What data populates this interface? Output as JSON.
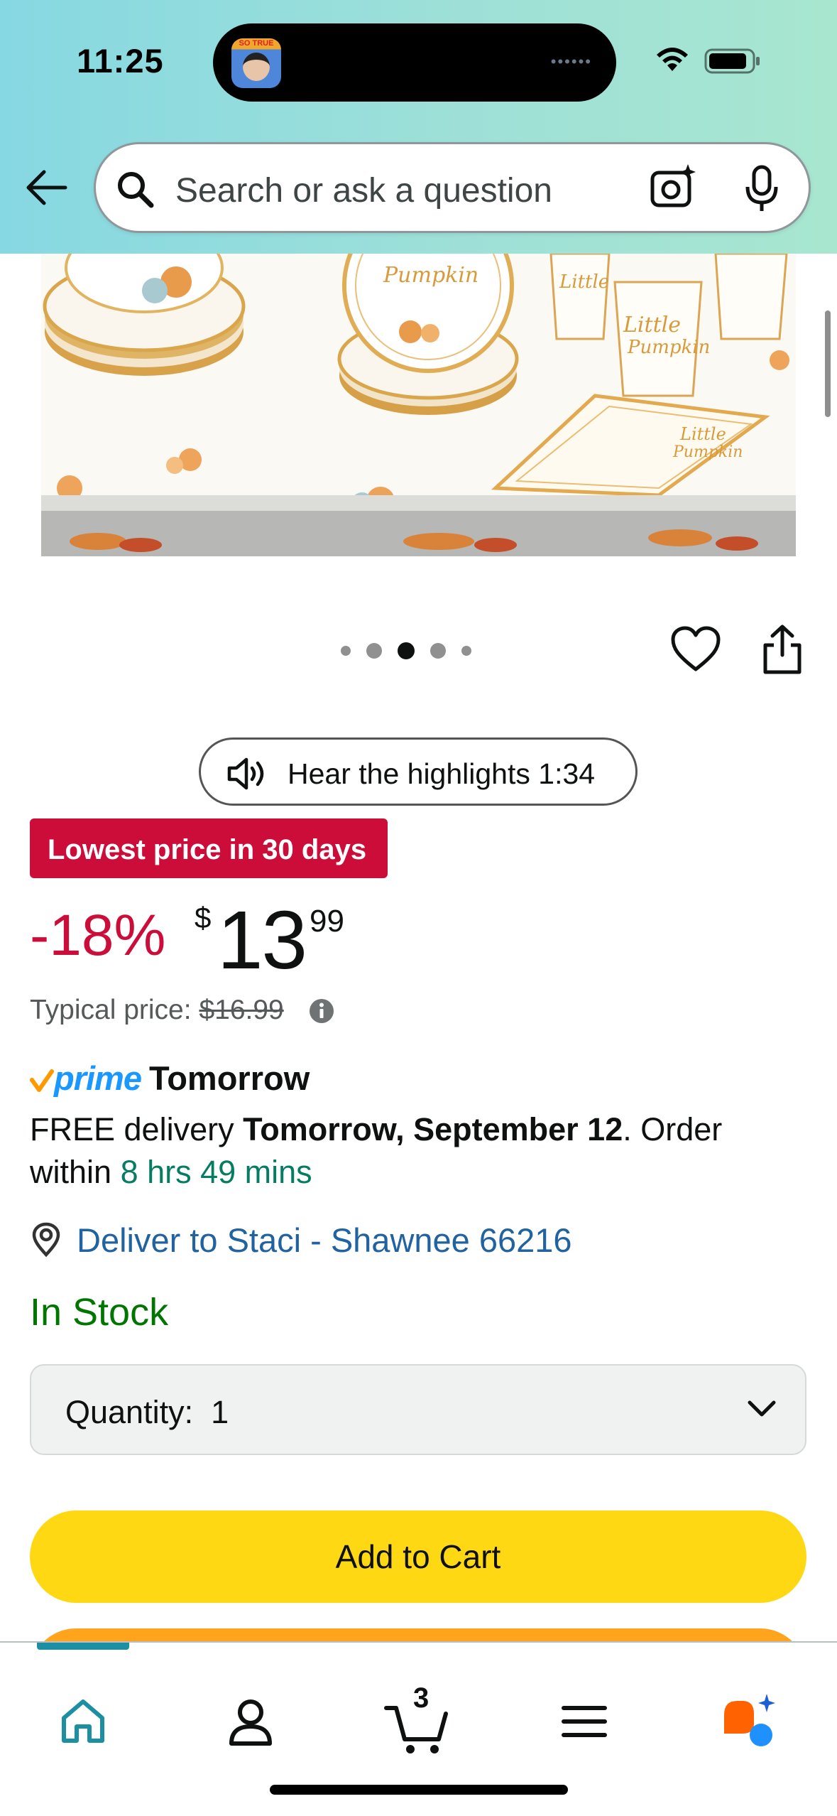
{
  "status_bar": {
    "time": "11:25",
    "island_badge": "SO TRUE"
  },
  "header": {
    "back_icon": "arrow-left-icon",
    "search_placeholder": "Search or ask a question",
    "camera_icon": "camera-sparkle-icon",
    "mic_icon": "microphone-icon"
  },
  "gallery": {
    "dots_count": 5,
    "active_dot": 3,
    "wishlist_icon": "heart-icon",
    "share_icon": "share-icon"
  },
  "audio": {
    "label": "Hear the highlights 1:34",
    "icon": "speaker-icon"
  },
  "pricing": {
    "deal_badge": "Lowest price in 30 days",
    "discount": "-18%",
    "currency_symbol": "$",
    "price_whole": "13",
    "price_fraction": "99",
    "typical_label": "Typical price:",
    "typical_price": "$16.99"
  },
  "delivery": {
    "prime_label": "prime",
    "prime_day": "Tomorrow",
    "free_text": "FREE delivery ",
    "date": "Tomorrow, September 12",
    "order_text": ". Order within ",
    "countdown": "8 hrs 49 mins",
    "deliver_to": "Deliver to Staci - Shawnee 66216"
  },
  "stock": {
    "status": "In Stock"
  },
  "quantity": {
    "label": "Quantity:",
    "value": "1"
  },
  "actions": {
    "add_to_cart": "Add to Cart"
  },
  "bottom_nav": {
    "items": [
      "home-icon",
      "account-icon",
      "cart-icon",
      "menu-icon",
      "rufus-ai-icon"
    ],
    "cart_count": "3",
    "active": "home-icon"
  },
  "colors": {
    "header_gradient_start": "#86d8e2",
    "header_gradient_end": "#a8e6cf",
    "deal_red": "#cc0c39",
    "link_blue": "#2162a1",
    "stock_green": "#007600",
    "countdown_green": "#067d62",
    "cart_yellow": "#ffd814",
    "buy_now_orange": "#ffa41c",
    "prime_blue": "#1a98ff",
    "nav_active": "#1c8fa3"
  }
}
